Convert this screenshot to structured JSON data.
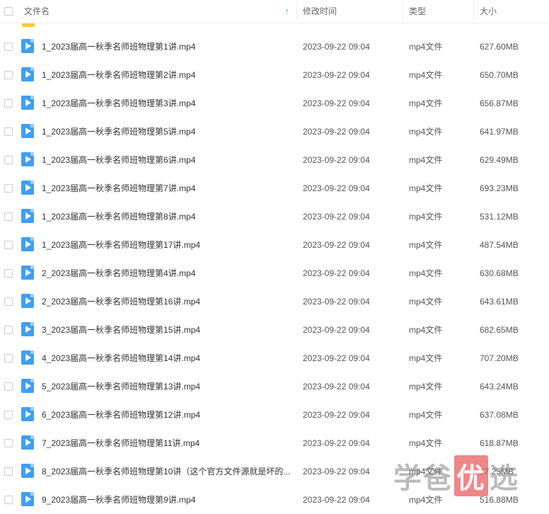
{
  "header": {
    "name_label": "文件名",
    "time_label": "修改时间",
    "type_label": "类型",
    "size_label": "大小",
    "sort_icon": "arrow-up-icon"
  },
  "files": [
    {
      "name": "1_2023届高一秋季名师班物理第1讲.mp4",
      "time": "2023-09-22 09:04",
      "type": "mp4文件",
      "size": "627.60MB"
    },
    {
      "name": "1_2023届高一秋季名师班物理第2讲.mp4",
      "time": "2023-09-22 09:04",
      "type": "mp4文件",
      "size": "650.70MB"
    },
    {
      "name": "1_2023届高一秋季名师班物理第3讲.mp4",
      "time": "2023-09-22 09:04",
      "type": "mp4文件",
      "size": "656.87MB"
    },
    {
      "name": "1_2023届高一秋季名师班物理第5讲.mp4",
      "time": "2023-09-22 09:04",
      "type": "mp4文件",
      "size": "641.97MB"
    },
    {
      "name": "1_2023届高一秋季名师班物理第6讲.mp4",
      "time": "2023-09-22 09:04",
      "type": "mp4文件",
      "size": "629.49MB"
    },
    {
      "name": "1_2023届高一秋季名师班物理第7讲.mp4",
      "time": "2023-09-22 09:04",
      "type": "mp4文件",
      "size": "693.23MB"
    },
    {
      "name": "1_2023届高一秋季名师班物理第8讲.mp4",
      "time": "2023-09-22 09:04",
      "type": "mp4文件",
      "size": "531.12MB"
    },
    {
      "name": "1_2023届高一秋季名师班物理第17讲.mp4",
      "time": "2023-09-22 09:04",
      "type": "mp4文件",
      "size": "487.54MB"
    },
    {
      "name": "2_2023届高一秋季名师班物理第4讲.mp4",
      "time": "2023-09-22 09:04",
      "type": "mp4文件",
      "size": "630.68MB"
    },
    {
      "name": "2_2023届高一秋季名师班物理第16讲.mp4",
      "time": "2023-09-22 09:04",
      "type": "mp4文件",
      "size": "643.61MB"
    },
    {
      "name": "3_2023届高一秋季名师班物理第15讲.mp4",
      "time": "2023-09-22 09:04",
      "type": "mp4文件",
      "size": "682.65MB"
    },
    {
      "name": "4_2023届高一秋季名师班物理第14讲.mp4",
      "time": "2023-09-22 09:04",
      "type": "mp4文件",
      "size": "707.20MB"
    },
    {
      "name": "5_2023届高一秋季名师班物理第13讲.mp4",
      "time": "2023-09-22 09:04",
      "type": "mp4文件",
      "size": "643.24MB"
    },
    {
      "name": "6_2023届高一秋季名师班物理第12讲.mp4",
      "time": "2023-09-22 09:04",
      "type": "mp4文件",
      "size": "637.08MB"
    },
    {
      "name": "7_2023届高一秋季名师班物理第11讲.mp4",
      "time": "2023-09-22 09:04",
      "type": "mp4文件",
      "size": "618.87MB"
    },
    {
      "name": "8_2023届高一秋季名师班物理第10讲（这个官方文件源就是坏的...",
      "time": "2023-09-22 09:04",
      "type": "mp4文件",
      "size": "87.25MB"
    },
    {
      "name": "9_2023届高一秋季名师班物理第9讲.mp4",
      "time": "2023-09-22 09:04",
      "type": "mp4文件",
      "size": "516.88MB"
    }
  ],
  "icons": {
    "file": "video-file-icon",
    "folder": "folder-icon",
    "checkbox": "checkbox-icon"
  },
  "colors": {
    "accent": "#06a7ff",
    "file_icon": "#3d9ff7",
    "folder_icon": "#ffc53d",
    "watermark_box": "#e64646"
  },
  "watermark": {
    "part1": "学爸",
    "box": "优",
    "part2": "选"
  }
}
